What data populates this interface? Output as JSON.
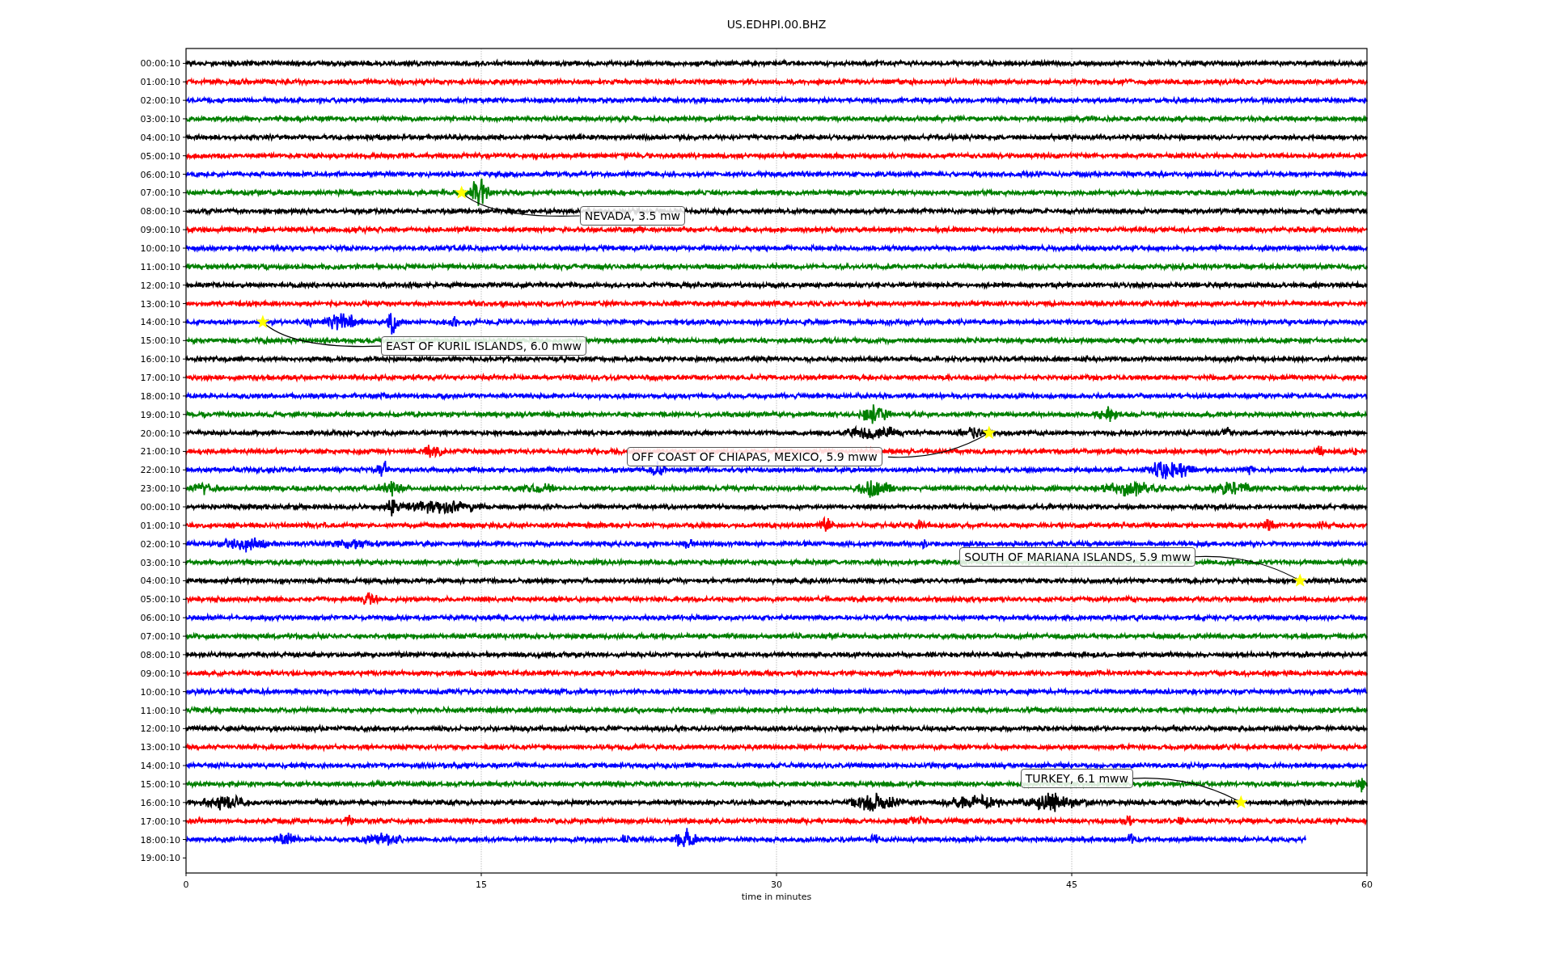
{
  "figure": {
    "title": "US.EDHPI.00.BHZ",
    "axes": {
      "xlabel": "time in minutes",
      "xticks": [
        "0",
        "15",
        "30",
        "45",
        "60"
      ],
      "ytick_labels": [
        "00:00:10",
        "01:00:10",
        "02:00:10",
        "03:00:10",
        "04:00:10",
        "05:00:10",
        "06:00:10",
        "07:00:10",
        "08:00:10",
        "09:00:10",
        "10:00:10",
        "11:00:10",
        "12:00:10",
        "13:00:10",
        "14:00:10",
        "15:00:10",
        "16:00:10",
        "17:00:10",
        "18:00:10",
        "19:00:10",
        "20:00:10",
        "21:00:10",
        "22:00:10",
        "23:00:10",
        "00:00:10",
        "01:00:10",
        "02:00:10",
        "03:00:10",
        "04:00:10",
        "05:00:10",
        "06:00:10",
        "07:00:10",
        "08:00:10",
        "09:00:10",
        "10:00:10",
        "11:00:10",
        "12:00:10",
        "13:00:10",
        "14:00:10",
        "15:00:10",
        "16:00:10",
        "17:00:10",
        "18:00:10",
        "19:00:10"
      ]
    },
    "traces": [
      {
        "color": "#000000",
        "complete": true
      },
      {
        "color": "#ff0000",
        "complete": true
      },
      {
        "color": "#0000ff",
        "complete": true
      },
      {
        "color": "#008000",
        "complete": true
      },
      {
        "color": "#000000",
        "complete": true
      },
      {
        "color": "#ff0000",
        "complete": true
      },
      {
        "color": "#0000ff",
        "complete": true
      },
      {
        "color": "#008000",
        "complete": true
      },
      {
        "color": "#000000",
        "complete": true
      },
      {
        "color": "#ff0000",
        "complete": true
      },
      {
        "color": "#0000ff",
        "complete": true
      },
      {
        "color": "#008000",
        "complete": true
      },
      {
        "color": "#000000",
        "complete": true
      },
      {
        "color": "#ff0000",
        "complete": true
      },
      {
        "color": "#0000ff",
        "complete": true
      },
      {
        "color": "#008000",
        "complete": true
      },
      {
        "color": "#000000",
        "complete": true
      },
      {
        "color": "#ff0000",
        "complete": true
      },
      {
        "color": "#0000ff",
        "complete": true
      },
      {
        "color": "#008000",
        "complete": true
      },
      {
        "color": "#000000",
        "complete": true
      },
      {
        "color": "#ff0000",
        "complete": true
      },
      {
        "color": "#0000ff",
        "complete": true
      },
      {
        "color": "#008000",
        "complete": true
      },
      {
        "color": "#000000",
        "complete": true
      },
      {
        "color": "#ff0000",
        "complete": true
      },
      {
        "color": "#0000ff",
        "complete": true
      },
      {
        "color": "#008000",
        "complete": true
      },
      {
        "color": "#000000",
        "complete": true
      },
      {
        "color": "#ff0000",
        "complete": true
      },
      {
        "color": "#0000ff",
        "complete": true
      },
      {
        "color": "#008000",
        "complete": true
      },
      {
        "color": "#000000",
        "complete": true
      },
      {
        "color": "#ff0000",
        "complete": true
      },
      {
        "color": "#0000ff",
        "complete": true
      },
      {
        "color": "#008000",
        "complete": true
      },
      {
        "color": "#000000",
        "complete": true
      },
      {
        "color": "#ff0000",
        "complete": true
      },
      {
        "color": "#0000ff",
        "complete": true
      },
      {
        "color": "#008000",
        "complete": true
      },
      {
        "color": "#000000",
        "complete": true
      },
      {
        "color": "#ff0000",
        "complete": true
      },
      {
        "color": "#0000ff",
        "complete": false
      }
    ],
    "annotations": [
      {
        "text": "NEVADA, 3.5 mw"
      },
      {
        "text": "EAST OF KURIL ISLANDS, 6.0 mww"
      },
      {
        "text": "OFF COAST OF CHIAPAS, MEXICO, 5.9 mww"
      },
      {
        "text": "SOUTH OF MARIANA ISLANDS, 5.9 mww"
      },
      {
        "text": "TURKEY, 6.1 mww"
      }
    ]
  }
}
